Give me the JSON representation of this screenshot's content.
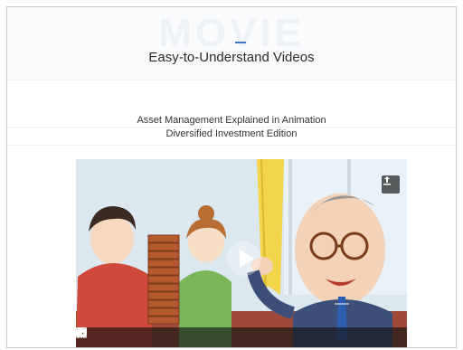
{
  "header": {
    "watermark": "MOVIE",
    "title": "Easy-to-Understand Videos"
  },
  "video_section": {
    "subtitle_line1": "Asset Management Explained in Animation",
    "subtitle_line2": "Diversified Investment Edition"
  },
  "video_player": {
    "controls": [
      "play-icon",
      "rewind-icon",
      "forward-icon",
      "volume-icon",
      "settings-icon",
      "captions-icon",
      "fullscreen-icon"
    ],
    "share_icon": "share-icon",
    "big_play_icon": "play-icon"
  },
  "colors": {
    "accent": "#3b7bc9",
    "title_text": "#2b2b2b"
  }
}
